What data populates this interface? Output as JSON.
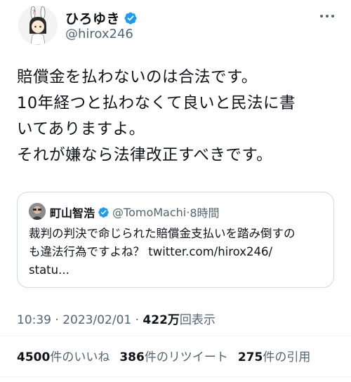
{
  "author": {
    "display_name": "ひろゆき",
    "handle": "@hirox246",
    "avatar_icon": "avatar-image",
    "verified_icon": "verified-badge-icon"
  },
  "menu_icon": "more-options-icon",
  "tweet": {
    "lines": [
      "賠償金を払わないのは合法です。",
      "10年経つと払わなくて良いと民法に書",
      "いてありますよ。",
      "それが嫌なら法律改正すべきです。"
    ]
  },
  "quote": {
    "name": "町山智浩",
    "handle": "@TomoMachi",
    "separator": "·",
    "time": "8時間",
    "lines": [
      "裁判の判決で命じられた賠償金支払いを踏み倒すの",
      "も違法行為ですよね？ twitter.com/hirox246/",
      "statu..."
    ]
  },
  "meta": {
    "time": "10:39",
    "separator": "·",
    "date": "2023/02/01",
    "separator2": "·",
    "views_count": "422万",
    "views_label": "回表示"
  },
  "stats": {
    "likes_count": "4500",
    "likes_label": "件のいいね",
    "retweets_count": "386",
    "retweets_label": "件のリツイート",
    "quotes_count": "275",
    "quotes_label": "件の引用"
  },
  "colors": {
    "text": "#0f1419",
    "secondary": "#536471",
    "verified": "#1d9bf0",
    "border": "#cfd9de"
  }
}
